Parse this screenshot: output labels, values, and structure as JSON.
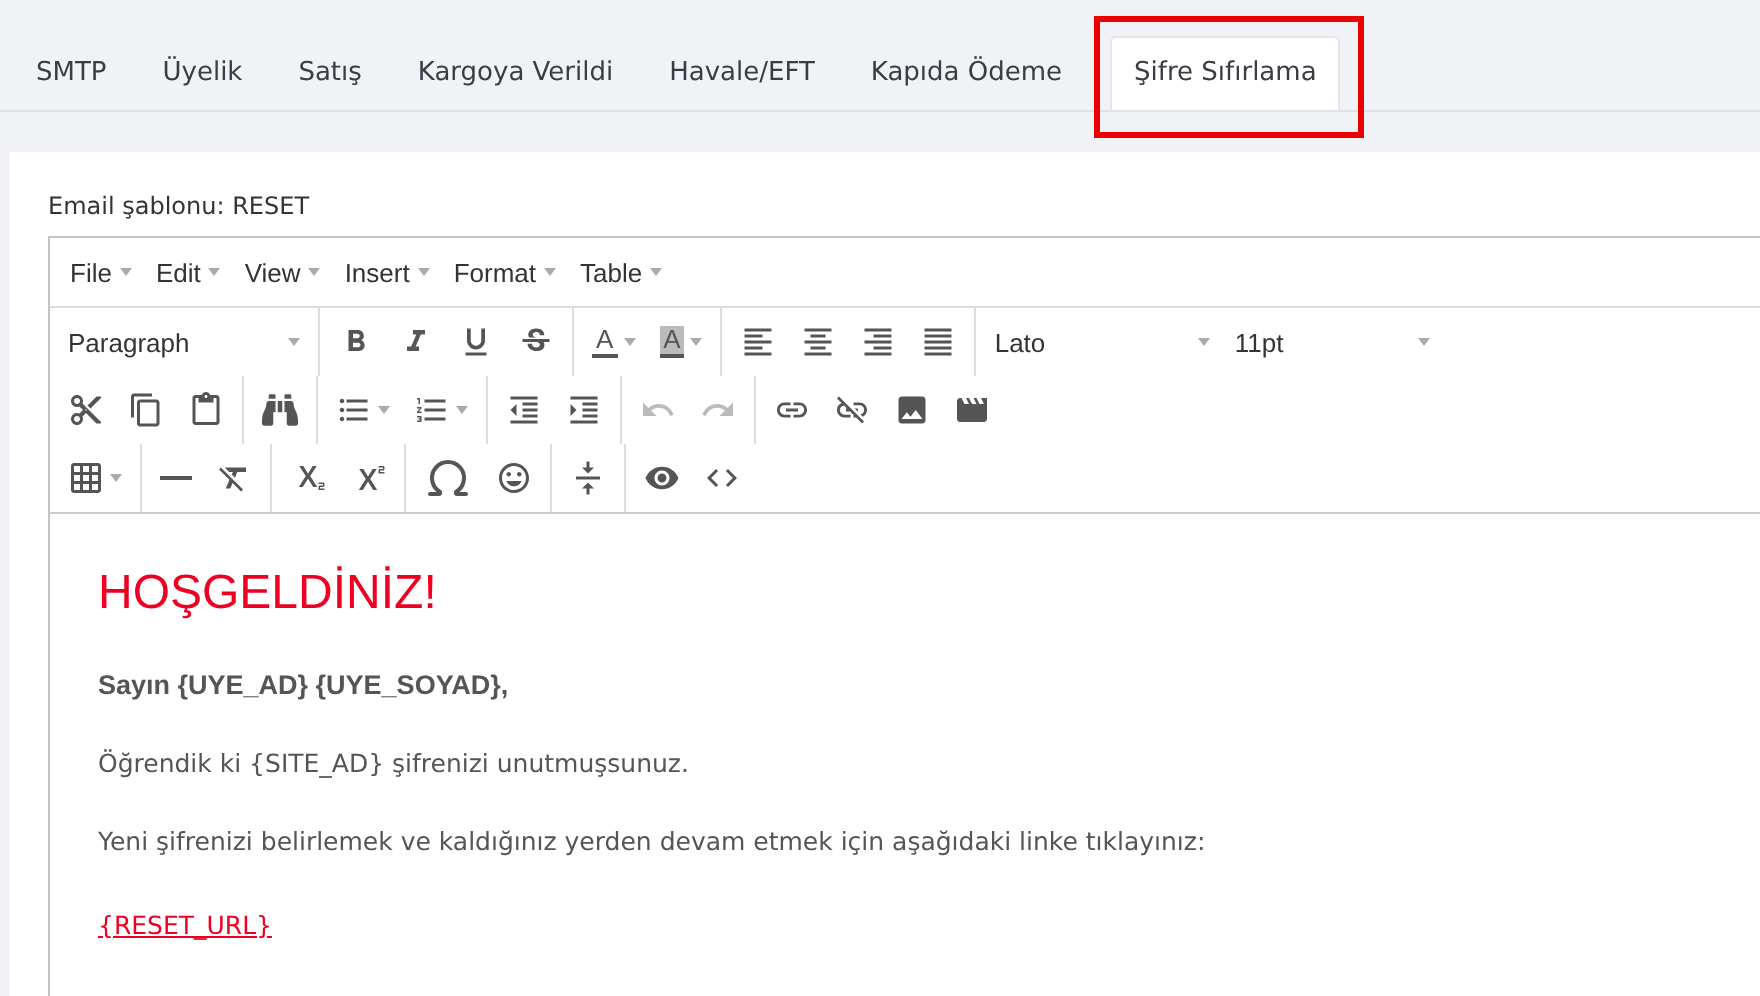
{
  "tabs": [
    {
      "label": "SMTP",
      "selected": false,
      "highlighted": false
    },
    {
      "label": "Üyelik",
      "selected": false,
      "highlighted": false
    },
    {
      "label": "Satış",
      "selected": false,
      "highlighted": false
    },
    {
      "label": "Kargoya Verildi",
      "selected": false,
      "highlighted": false
    },
    {
      "label": "Havale/EFT",
      "selected": false,
      "highlighted": false
    },
    {
      "label": "Kapıda Ödeme",
      "selected": false,
      "highlighted": false
    },
    {
      "label": "Şifre Sıfırlama",
      "selected": true,
      "highlighted": true
    }
  ],
  "template_label": "Email şablonu: RESET",
  "editor": {
    "menu": [
      "File",
      "Edit",
      "View",
      "Insert",
      "Format",
      "Table"
    ],
    "block_format": "Paragraph",
    "text_color": "A",
    "background_color": "A",
    "font_family": "Lato",
    "font_size": "11pt",
    "undo_disabled": true,
    "redo_disabled": true,
    "content": [
      {
        "kind": "heading",
        "text": "HOŞGELDİNİZ!"
      },
      {
        "kind": "bold",
        "text": "Sayın {UYE_AD} {UYE_SOYAD},"
      },
      {
        "kind": "text",
        "text": "Öğrendik ki {SITE_AD} şifrenizi unutmuşsunuz."
      },
      {
        "kind": "text",
        "text": "Yeni şifrenizi belirlemek ve kaldığınız yerden devam etmek için aşağıdaki linke tıklayınız:"
      },
      {
        "kind": "link",
        "text": "{RESET_URL}"
      }
    ]
  }
}
